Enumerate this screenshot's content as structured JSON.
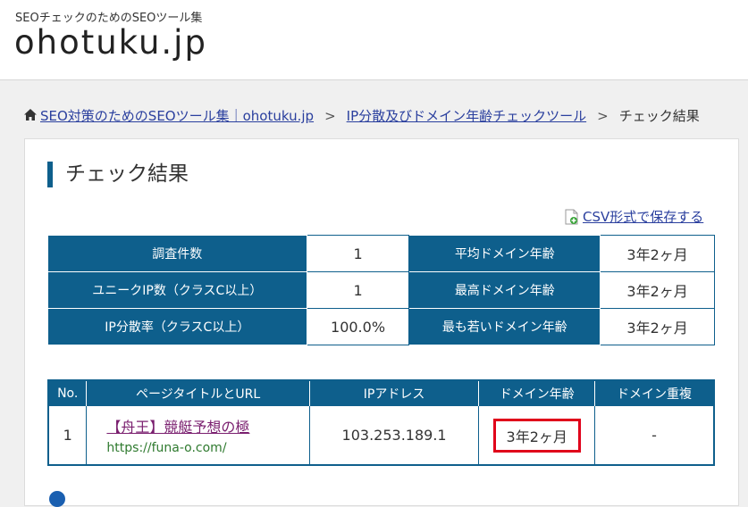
{
  "header": {
    "tagline": "SEOチェックのためのSEOツール集",
    "logo": "ohotuku.jp"
  },
  "breadcrumb": {
    "home_label": "SEO対策のためのSEOツール集｜ohotuku.jp",
    "tool_label": "IP分散及びドメイン年齢チェックツール",
    "current_label": "チェック結果",
    "separator": ">"
  },
  "card": {
    "title": "チェック結果",
    "csv_label": "CSV形式で保存する"
  },
  "summary": {
    "rows": [
      {
        "label1": "調査件数",
        "value1": "1",
        "label2": "平均ドメイン年齢",
        "value2": "3年2ヶ月"
      },
      {
        "label1": "ユニークIP数（クラスC以上）",
        "value1": "1",
        "label2": "最高ドメイン年齢",
        "value2": "3年2ヶ月"
      },
      {
        "label1": "IP分散率（クラスC以上）",
        "value1": "100.0%",
        "label2": "最も若いドメイン年齢",
        "value2": "3年2ヶ月"
      }
    ]
  },
  "results": {
    "headers": [
      "No.",
      "ページタイトルとURL",
      "IPアドレス",
      "ドメイン年齢",
      "ドメイン重複"
    ],
    "rows": [
      {
        "no": "1",
        "title": "【舟王】競艇予想の極",
        "url": "https://funa-o.com/",
        "ip": "103.253.189.1",
        "age": "3年2ヶ月",
        "dup": "-"
      }
    ]
  },
  "colors": {
    "accent": "#0e5f8c",
    "highlight": "#e0001a",
    "link": "#2a3f9e"
  }
}
